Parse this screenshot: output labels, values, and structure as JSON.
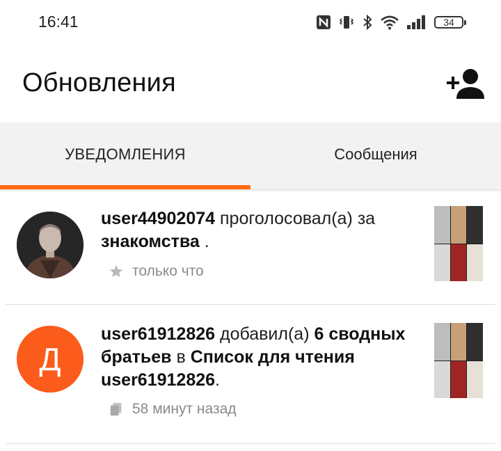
{
  "status_bar": {
    "time": "16:41",
    "icons": [
      "nfc-icon",
      "vibrate-icon",
      "bluetooth-icon",
      "wifi-icon",
      "signal-icon"
    ],
    "battery": "34"
  },
  "header": {
    "title": "Обновления",
    "add_user_icon": "add-user-icon"
  },
  "tabs": [
    {
      "label": "УВЕДОМЛЕНИЯ",
      "active": true
    },
    {
      "label": "Сообщения",
      "active": false
    }
  ],
  "colors": {
    "accent": "#ff6a13",
    "avatar_orange": "#fb5b1b",
    "tab_bar_bg": "#f2f2f2",
    "meta_gray": "#8a8a8a"
  },
  "notifications": [
    {
      "user": "user44902074",
      "action": "проголосовал(а) за",
      "target": "знакомства",
      "end": ".",
      "time": "только что",
      "meta_icon": "star-icon"
    },
    {
      "user": "user61912826",
      "action": "добавил(а)",
      "story": "6 сводных братьев",
      "in_word": "в",
      "list": "Список для чтения user61912826",
      "end": ".",
      "time": "58 минут назад",
      "meta_icon": "copy-icon",
      "avatar_letter": "Д"
    }
  ]
}
